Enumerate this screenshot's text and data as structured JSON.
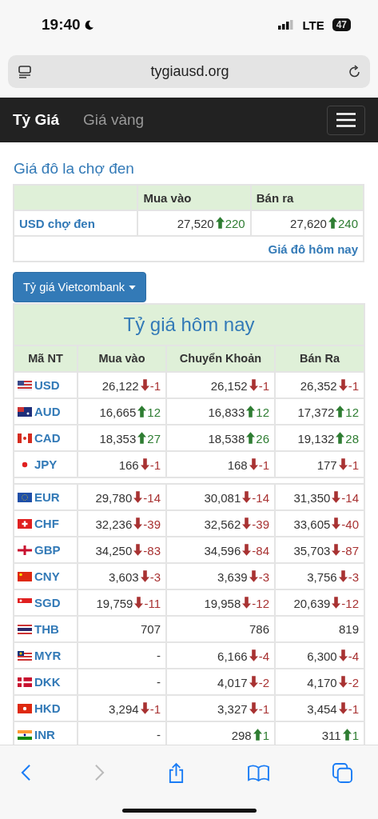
{
  "status_bar": {
    "time": "19:40",
    "network": "LTE",
    "battery": "47"
  },
  "address_bar": {
    "url": "tygiausd.org"
  },
  "nav": {
    "brand": "Tỷ Giá",
    "links": [
      {
        "label": "Giá vàng"
      }
    ]
  },
  "black_market": {
    "title": "Giá đô la chợ đen",
    "columns": [
      "Mua vào",
      "Bán ra"
    ],
    "row_label": "USD chợ đen",
    "cells": [
      {
        "value": "27,520",
        "change": "220",
        "up": true
      },
      {
        "value": "27,620",
        "change": "240",
        "up": true
      }
    ],
    "link": "Giá đô hôm nay"
  },
  "bank_dropdown": {
    "label": "Tỷ giá Vietcombank"
  },
  "rates": {
    "title": "Tỷ giá hôm nay",
    "columns": [
      "Mã NT",
      "Mua vào",
      "Chuyển Khoản",
      "Bán Ra"
    ],
    "groups": [
      [
        {
          "code": "USD",
          "cells": [
            {
              "value": "26,122",
              "change": "-1",
              "up": false
            },
            {
              "value": "26,152",
              "change": "-1",
              "up": false
            },
            {
              "value": "26,352",
              "change": "-1",
              "up": false
            }
          ]
        },
        {
          "code": "AUD",
          "cells": [
            {
              "value": "16,665",
              "change": "12",
              "up": true
            },
            {
              "value": "16,833",
              "change": "12",
              "up": true
            },
            {
              "value": "17,372",
              "change": "12",
              "up": true
            }
          ]
        },
        {
          "code": "CAD",
          "cells": [
            {
              "value": "18,353",
              "change": "27",
              "up": true
            },
            {
              "value": "18,538",
              "change": "26",
              "up": true
            },
            {
              "value": "19,132",
              "change": "28",
              "up": true
            }
          ]
        },
        {
          "code": "JPY",
          "cells": [
            {
              "value": "166",
              "change": "-1",
              "up": false
            },
            {
              "value": "168",
              "change": "-1",
              "up": false
            },
            {
              "value": "177",
              "change": "-1",
              "up": false
            }
          ]
        }
      ],
      [
        {
          "code": "EUR",
          "cells": [
            {
              "value": "29,780",
              "change": "-14",
              "up": false
            },
            {
              "value": "30,081",
              "change": "-14",
              "up": false
            },
            {
              "value": "31,350",
              "change": "-14",
              "up": false
            }
          ]
        },
        {
          "code": "CHF",
          "cells": [
            {
              "value": "32,236",
              "change": "-39",
              "up": false
            },
            {
              "value": "32,562",
              "change": "-39",
              "up": false
            },
            {
              "value": "33,605",
              "change": "-40",
              "up": false
            }
          ]
        },
        {
          "code": "GBP",
          "cells": [
            {
              "value": "34,250",
              "change": "-83",
              "up": false
            },
            {
              "value": "34,596",
              "change": "-84",
              "up": false
            },
            {
              "value": "35,703",
              "change": "-87",
              "up": false
            }
          ]
        },
        {
          "code": "CNY",
          "cells": [
            {
              "value": "3,603",
              "change": "-3",
              "up": false
            },
            {
              "value": "3,639",
              "change": "-3",
              "up": false
            },
            {
              "value": "3,756",
              "change": "-3",
              "up": false
            }
          ]
        },
        {
          "code": "SGD",
          "cells": [
            {
              "value": "19,759",
              "change": "-11",
              "up": false
            },
            {
              "value": "19,958",
              "change": "-12",
              "up": false
            },
            {
              "value": "20,639",
              "change": "-12",
              "up": false
            }
          ]
        },
        {
          "code": "THB",
          "cells": [
            {
              "value": "707"
            },
            {
              "value": "786"
            },
            {
              "value": "819"
            }
          ]
        },
        {
          "code": "MYR",
          "cells": [
            {
              "value": "-"
            },
            {
              "value": "6,166",
              "change": "-4",
              "up": false
            },
            {
              "value": "6,300",
              "change": "-4",
              "up": false
            }
          ]
        },
        {
          "code": "DKK",
          "cells": [
            {
              "value": "-"
            },
            {
              "value": "4,017",
              "change": "-2",
              "up": false
            },
            {
              "value": "4,170",
              "change": "-2",
              "up": false
            }
          ]
        },
        {
          "code": "HKD",
          "cells": [
            {
              "value": "3,294",
              "change": "-1",
              "up": false
            },
            {
              "value": "3,327",
              "change": "-1",
              "up": false
            },
            {
              "value": "3,454",
              "change": "-1",
              "up": false
            }
          ]
        },
        {
          "code": "INR",
          "cells": [
            {
              "value": "-"
            },
            {
              "value": "298",
              "change": "1",
              "up": true
            },
            {
              "value": "311",
              "change": "1",
              "up": true
            }
          ]
        }
      ]
    ]
  }
}
